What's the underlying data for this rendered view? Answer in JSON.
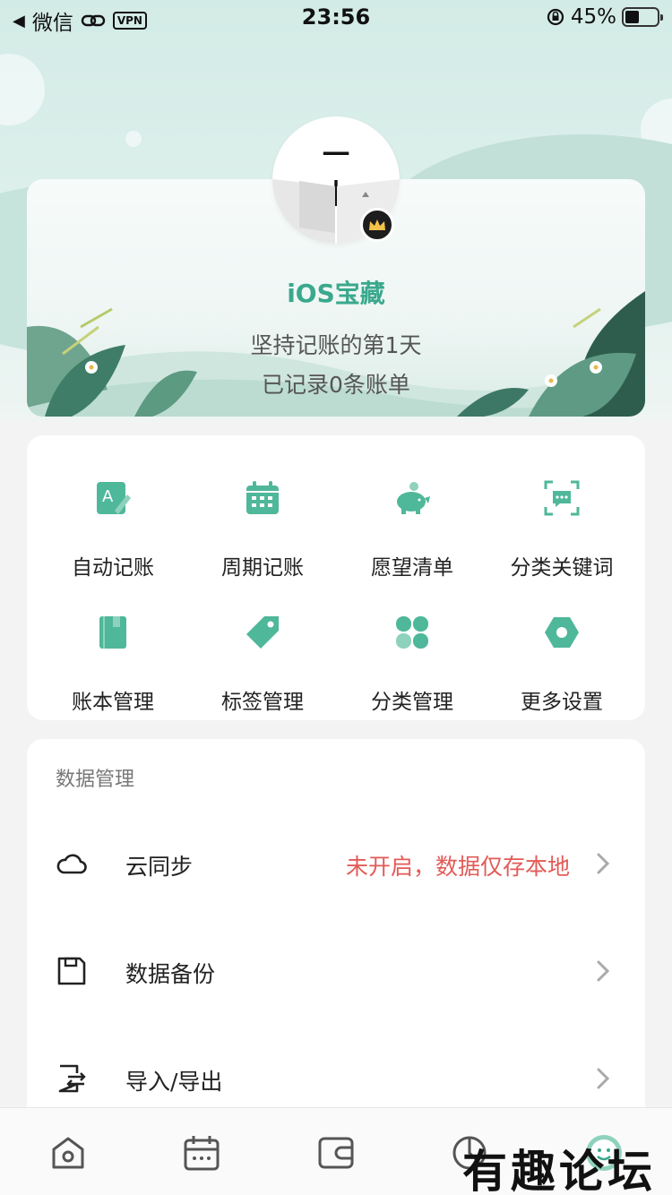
{
  "status_bar": {
    "back_app": "微信",
    "vpn": "VPN",
    "time": "23:56",
    "battery": "45%",
    "battery_level": 0.45
  },
  "profile": {
    "avatar_text": "一 木",
    "username": "iOS宝藏",
    "days_text": "坚持记账的第1天",
    "records_text": "已记录0条账单"
  },
  "features": [
    {
      "label": "自动记账",
      "icon": "auto-entry-icon"
    },
    {
      "label": "周期记账",
      "icon": "calendar-icon"
    },
    {
      "label": "愿望清单",
      "icon": "piggy-bank-icon"
    },
    {
      "label": "分类关键词",
      "icon": "keyword-scan-icon"
    },
    {
      "label": "账本管理",
      "icon": "ledger-book-icon"
    },
    {
      "label": "标签管理",
      "icon": "tag-icon"
    },
    {
      "label": "分类管理",
      "icon": "category-grid-icon"
    },
    {
      "label": "更多设置",
      "icon": "settings-hexagon-icon"
    }
  ],
  "data_section": {
    "title": "数据管理",
    "rows": [
      {
        "label": "云同步",
        "status": "未开启，数据仅存本地",
        "icon": "cloud-icon"
      },
      {
        "label": "数据备份",
        "status": "",
        "icon": "save-icon"
      },
      {
        "label": "导入/导出",
        "status": "",
        "icon": "import-export-icon"
      }
    ]
  },
  "tab_bar": [
    "home-icon",
    "calendar-tab-icon",
    "wallet-icon",
    "stats-icon",
    "profile-icon"
  ],
  "watermark": "有趣论坛",
  "colors": {
    "accent": "#3aa88c",
    "warning": "#e25b57",
    "icon_green": "#4fb79a"
  }
}
